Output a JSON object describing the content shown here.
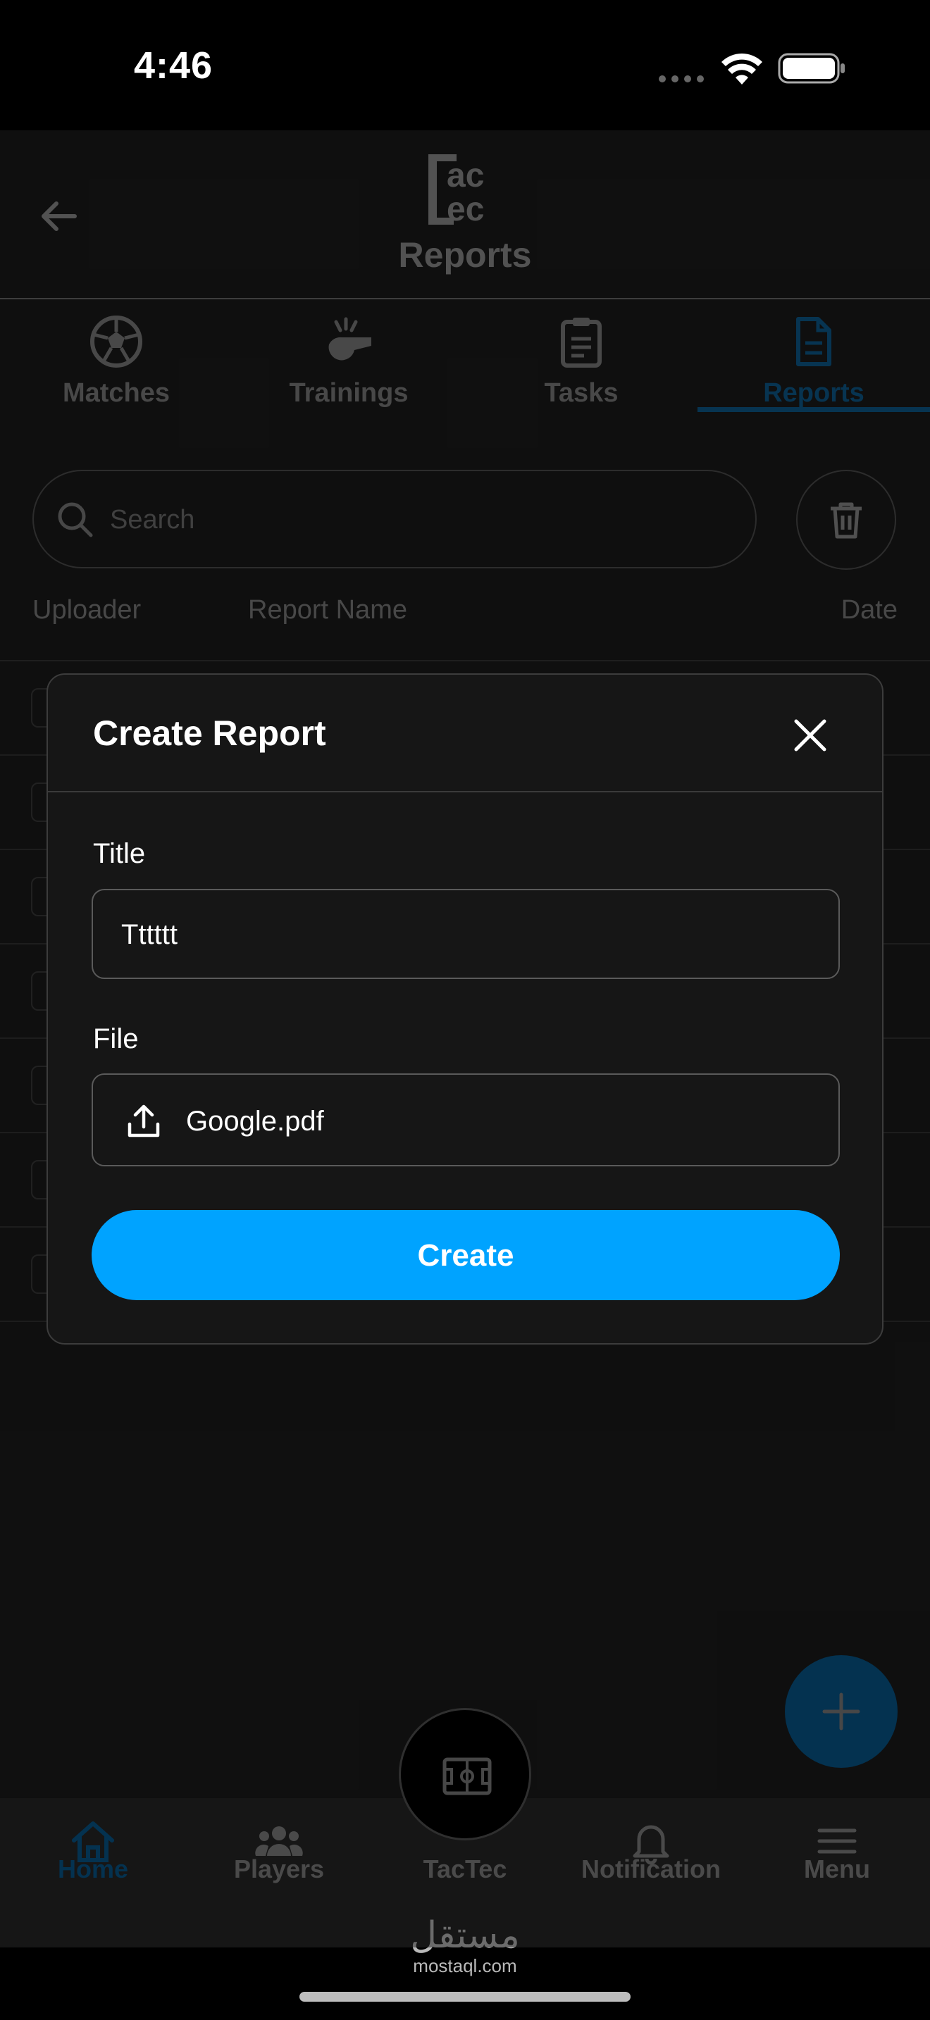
{
  "status_bar": {
    "time": "4:46"
  },
  "header": {
    "title": "Reports",
    "logo_text": "tac tec"
  },
  "tabs": [
    {
      "label": "Matches",
      "icon": "soccer-ball-icon",
      "active": false
    },
    {
      "label": "Trainings",
      "icon": "whistle-icon",
      "active": false
    },
    {
      "label": "Tasks",
      "icon": "clipboard-icon",
      "active": false
    },
    {
      "label": "Reports",
      "icon": "document-icon",
      "active": true
    }
  ],
  "search": {
    "placeholder": "Search",
    "value": ""
  },
  "table": {
    "columns": [
      "Uploader",
      "Report Name",
      "Date"
    ],
    "row_count": 7
  },
  "modal": {
    "title": "Create Report",
    "title_label": "Title",
    "title_value": "Tttttt",
    "file_label": "File",
    "file_name": "Google.pdf",
    "submit_label": "Create"
  },
  "bottom_nav": [
    {
      "label": "Home",
      "icon": "home-icon",
      "active": true
    },
    {
      "label": "Players",
      "icon": "players-icon",
      "active": false
    },
    {
      "label": "TacTec",
      "icon": "pitch-icon",
      "active": false
    },
    {
      "label": "Notification",
      "icon": "bell-icon",
      "active": false
    },
    {
      "label": "Menu",
      "icon": "menu-icon",
      "active": false
    }
  ],
  "watermark": {
    "arabic": "مستقل",
    "url": "mostaql.com"
  },
  "colors": {
    "accent": "#00a3ff",
    "active_tab": "#0d5a8c",
    "background": "#1b1b1b"
  }
}
